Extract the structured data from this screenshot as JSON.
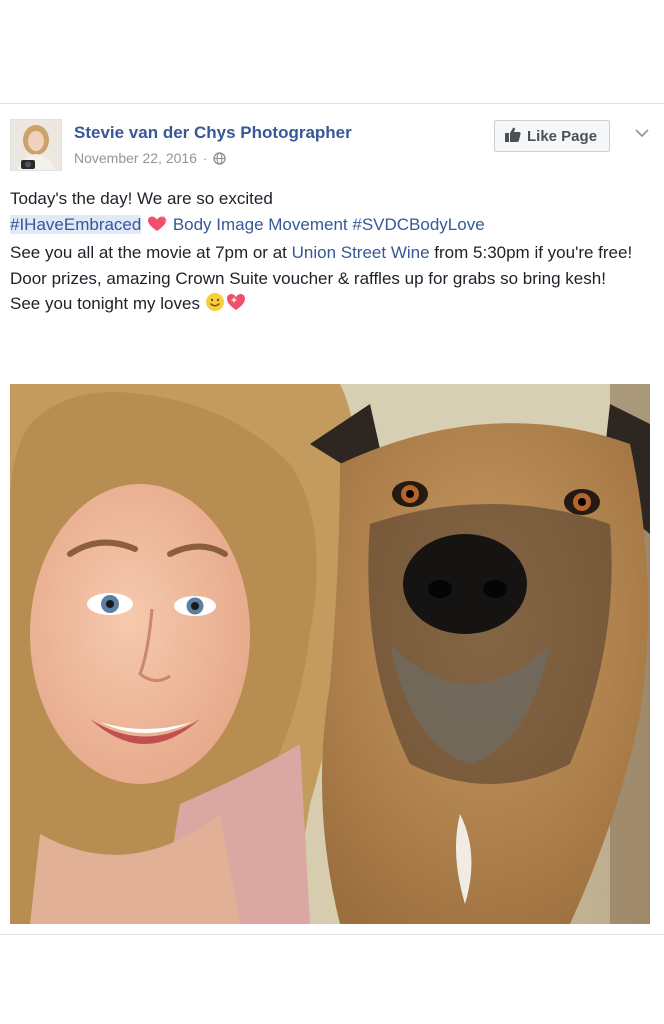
{
  "post": {
    "author": "Stevie van der Chys Photographer",
    "date": "November 22, 2016",
    "separator": "·",
    "like_button": "Like Page",
    "lines": {
      "line1": "Today's the day! We are so excited",
      "hashtag1": "#IHaveEmbraced",
      "page_mention": "Body Image Movement",
      "hashtag2": "#SVDCBodyLove",
      "line3_a": "See you all at the movie at 7pm or at",
      "venue": "Union Street Wine",
      "line3_b": "from 5:30pm if you're free!",
      "line4": "Door prizes, amazing Crown Suite voucher & raffles up for grabs so bring kesh!",
      "line5": "See you tonight my loves"
    }
  },
  "icons": {
    "globe": "globe-icon",
    "thumbs_up": "thumbs-up-icon",
    "chevron": "chevron-down-icon",
    "heart": "heart-emoji-icon",
    "smile": "smile-emoji-icon",
    "sparkle_heart": "sparkling-heart-emoji-icon"
  },
  "colors": {
    "link": "#365899",
    "meta": "#90949c",
    "text": "#1d2129",
    "button_bg": "#f6f7f9"
  }
}
